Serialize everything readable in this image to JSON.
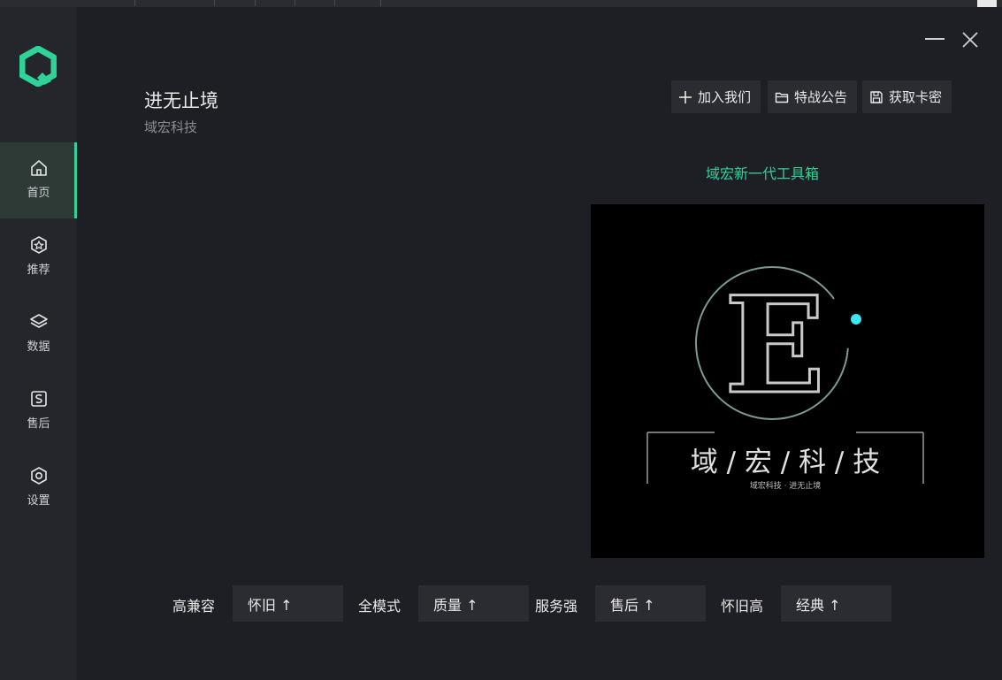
{
  "app": {
    "title": "进无止境",
    "subtitle": "域宏科技"
  },
  "sidebar": {
    "items": [
      {
        "label": "首页",
        "icon": "home-icon",
        "active": true
      },
      {
        "label": "推荐",
        "icon": "recommend-icon",
        "active": false
      },
      {
        "label": "数据",
        "icon": "layers-icon",
        "active": false
      },
      {
        "label": "售后",
        "icon": "service-icon",
        "active": false
      },
      {
        "label": "设置",
        "icon": "settings-icon",
        "active": false
      }
    ]
  },
  "toolbar": {
    "join_label": "加入我们",
    "notice_label": "特战公告",
    "card_label": "获取卡密"
  },
  "main": {
    "toolbox_label": "域宏新一代工具箱",
    "banner": {
      "letter": "E",
      "headline": "域 / 宏 / 科 / 技",
      "tagline": "域宏科技 · 进无止境"
    }
  },
  "stats": [
    {
      "label": "高兼容",
      "value": "怀旧 ↑"
    },
    {
      "label": "全模式",
      "value": "质量 ↑"
    },
    {
      "label": "服务强",
      "value": "售后 ↑"
    },
    {
      "label": "怀旧高",
      "value": "经典 ↑"
    }
  ],
  "colors": {
    "accent": "#2fd39a",
    "background": "#1e1f24",
    "sidebar": "#25262b",
    "button": "#2b2c31",
    "banner_dot": "#3ee6f0"
  }
}
